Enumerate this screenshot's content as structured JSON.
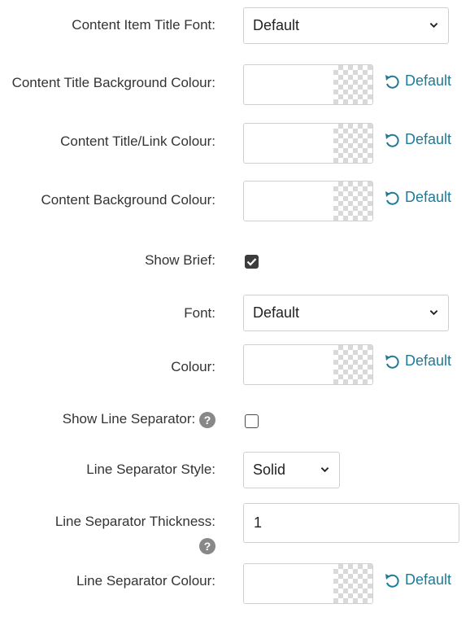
{
  "fields": {
    "content_item_title_font": {
      "label": "Content Item Title Font:",
      "value": "Default"
    },
    "content_title_background_colour": {
      "label": "Content Title Background Colour:",
      "reset_label": "Default"
    },
    "content_title_link_colour": {
      "label": "Content Title/Link Colour:",
      "reset_label": "Default"
    },
    "content_background_colour": {
      "label": "Content Background Colour:",
      "reset_label": "Default"
    },
    "show_brief": {
      "label": "Show Brief:",
      "checked": true
    },
    "font": {
      "label": "Font:",
      "value": "Default"
    },
    "colour": {
      "label": "Colour:",
      "reset_label": "Default"
    },
    "show_line_separator": {
      "label": "Show Line Separator:",
      "checked": false
    },
    "line_separator_style": {
      "label": "Line Separator Style:",
      "value": "Solid"
    },
    "line_separator_thickness": {
      "label": "Line Separator Thickness:",
      "value": "1"
    },
    "line_separator_colour": {
      "label": "Line Separator Colour:",
      "reset_label": "Default"
    }
  },
  "help_glyph": "?",
  "icons": [
    "chevron-down-icon",
    "reset-icon",
    "checkmark-icon",
    "help-icon"
  ],
  "colors": {
    "link": "#1f7a96",
    "text": "#333333",
    "border": "#cfcfcf",
    "help": "#888888"
  }
}
